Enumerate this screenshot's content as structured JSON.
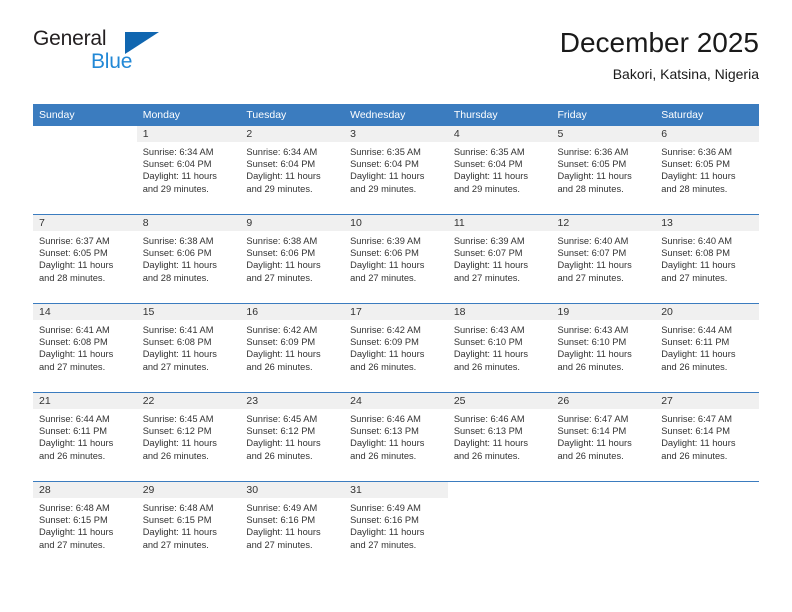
{
  "logo": {
    "line1": "General",
    "line2": "Blue",
    "triangle_color": "#1066b0",
    "blue_text_color": "#2288d6"
  },
  "header": {
    "title": "December 2025",
    "subtitle": "Bakori, Katsina, Nigeria"
  },
  "theme": {
    "header_blue": "#3b7cbf",
    "daynum_band": "#f0f0f0",
    "text": "#333333"
  },
  "weekdays": [
    "Sunday",
    "Monday",
    "Tuesday",
    "Wednesday",
    "Thursday",
    "Friday",
    "Saturday"
  ],
  "weeks": [
    [
      {
        "day": "",
        "blank": true
      },
      {
        "day": "1",
        "sunrise": "Sunrise: 6:34 AM",
        "sunset": "Sunset: 6:04 PM",
        "daylight1": "Daylight: 11 hours",
        "daylight2": "and 29 minutes."
      },
      {
        "day": "2",
        "sunrise": "Sunrise: 6:34 AM",
        "sunset": "Sunset: 6:04 PM",
        "daylight1": "Daylight: 11 hours",
        "daylight2": "and 29 minutes."
      },
      {
        "day": "3",
        "sunrise": "Sunrise: 6:35 AM",
        "sunset": "Sunset: 6:04 PM",
        "daylight1": "Daylight: 11 hours",
        "daylight2": "and 29 minutes."
      },
      {
        "day": "4",
        "sunrise": "Sunrise: 6:35 AM",
        "sunset": "Sunset: 6:04 PM",
        "daylight1": "Daylight: 11 hours",
        "daylight2": "and 29 minutes."
      },
      {
        "day": "5",
        "sunrise": "Sunrise: 6:36 AM",
        "sunset": "Sunset: 6:05 PM",
        "daylight1": "Daylight: 11 hours",
        "daylight2": "and 28 minutes."
      },
      {
        "day": "6",
        "sunrise": "Sunrise: 6:36 AM",
        "sunset": "Sunset: 6:05 PM",
        "daylight1": "Daylight: 11 hours",
        "daylight2": "and 28 minutes."
      }
    ],
    [
      {
        "day": "7",
        "sunrise": "Sunrise: 6:37 AM",
        "sunset": "Sunset: 6:05 PM",
        "daylight1": "Daylight: 11 hours",
        "daylight2": "and 28 minutes."
      },
      {
        "day": "8",
        "sunrise": "Sunrise: 6:38 AM",
        "sunset": "Sunset: 6:06 PM",
        "daylight1": "Daylight: 11 hours",
        "daylight2": "and 28 minutes."
      },
      {
        "day": "9",
        "sunrise": "Sunrise: 6:38 AM",
        "sunset": "Sunset: 6:06 PM",
        "daylight1": "Daylight: 11 hours",
        "daylight2": "and 27 minutes."
      },
      {
        "day": "10",
        "sunrise": "Sunrise: 6:39 AM",
        "sunset": "Sunset: 6:06 PM",
        "daylight1": "Daylight: 11 hours",
        "daylight2": "and 27 minutes."
      },
      {
        "day": "11",
        "sunrise": "Sunrise: 6:39 AM",
        "sunset": "Sunset: 6:07 PM",
        "daylight1": "Daylight: 11 hours",
        "daylight2": "and 27 minutes."
      },
      {
        "day": "12",
        "sunrise": "Sunrise: 6:40 AM",
        "sunset": "Sunset: 6:07 PM",
        "daylight1": "Daylight: 11 hours",
        "daylight2": "and 27 minutes."
      },
      {
        "day": "13",
        "sunrise": "Sunrise: 6:40 AM",
        "sunset": "Sunset: 6:08 PM",
        "daylight1": "Daylight: 11 hours",
        "daylight2": "and 27 minutes."
      }
    ],
    [
      {
        "day": "14",
        "sunrise": "Sunrise: 6:41 AM",
        "sunset": "Sunset: 6:08 PM",
        "daylight1": "Daylight: 11 hours",
        "daylight2": "and 27 minutes."
      },
      {
        "day": "15",
        "sunrise": "Sunrise: 6:41 AM",
        "sunset": "Sunset: 6:08 PM",
        "daylight1": "Daylight: 11 hours",
        "daylight2": "and 27 minutes."
      },
      {
        "day": "16",
        "sunrise": "Sunrise: 6:42 AM",
        "sunset": "Sunset: 6:09 PM",
        "daylight1": "Daylight: 11 hours",
        "daylight2": "and 26 minutes."
      },
      {
        "day": "17",
        "sunrise": "Sunrise: 6:42 AM",
        "sunset": "Sunset: 6:09 PM",
        "daylight1": "Daylight: 11 hours",
        "daylight2": "and 26 minutes."
      },
      {
        "day": "18",
        "sunrise": "Sunrise: 6:43 AM",
        "sunset": "Sunset: 6:10 PM",
        "daylight1": "Daylight: 11 hours",
        "daylight2": "and 26 minutes."
      },
      {
        "day": "19",
        "sunrise": "Sunrise: 6:43 AM",
        "sunset": "Sunset: 6:10 PM",
        "daylight1": "Daylight: 11 hours",
        "daylight2": "and 26 minutes."
      },
      {
        "day": "20",
        "sunrise": "Sunrise: 6:44 AM",
        "sunset": "Sunset: 6:11 PM",
        "daylight1": "Daylight: 11 hours",
        "daylight2": "and 26 minutes."
      }
    ],
    [
      {
        "day": "21",
        "sunrise": "Sunrise: 6:44 AM",
        "sunset": "Sunset: 6:11 PM",
        "daylight1": "Daylight: 11 hours",
        "daylight2": "and 26 minutes."
      },
      {
        "day": "22",
        "sunrise": "Sunrise: 6:45 AM",
        "sunset": "Sunset: 6:12 PM",
        "daylight1": "Daylight: 11 hours",
        "daylight2": "and 26 minutes."
      },
      {
        "day": "23",
        "sunrise": "Sunrise: 6:45 AM",
        "sunset": "Sunset: 6:12 PM",
        "daylight1": "Daylight: 11 hours",
        "daylight2": "and 26 minutes."
      },
      {
        "day": "24",
        "sunrise": "Sunrise: 6:46 AM",
        "sunset": "Sunset: 6:13 PM",
        "daylight1": "Daylight: 11 hours",
        "daylight2": "and 26 minutes."
      },
      {
        "day": "25",
        "sunrise": "Sunrise: 6:46 AM",
        "sunset": "Sunset: 6:13 PM",
        "daylight1": "Daylight: 11 hours",
        "daylight2": "and 26 minutes."
      },
      {
        "day": "26",
        "sunrise": "Sunrise: 6:47 AM",
        "sunset": "Sunset: 6:14 PM",
        "daylight1": "Daylight: 11 hours",
        "daylight2": "and 26 minutes."
      },
      {
        "day": "27",
        "sunrise": "Sunrise: 6:47 AM",
        "sunset": "Sunset: 6:14 PM",
        "daylight1": "Daylight: 11 hours",
        "daylight2": "and 26 minutes."
      }
    ],
    [
      {
        "day": "28",
        "sunrise": "Sunrise: 6:48 AM",
        "sunset": "Sunset: 6:15 PM",
        "daylight1": "Daylight: 11 hours",
        "daylight2": "and 27 minutes."
      },
      {
        "day": "29",
        "sunrise": "Sunrise: 6:48 AM",
        "sunset": "Sunset: 6:15 PM",
        "daylight1": "Daylight: 11 hours",
        "daylight2": "and 27 minutes."
      },
      {
        "day": "30",
        "sunrise": "Sunrise: 6:49 AM",
        "sunset": "Sunset: 6:16 PM",
        "daylight1": "Daylight: 11 hours",
        "daylight2": "and 27 minutes."
      },
      {
        "day": "31",
        "sunrise": "Sunrise: 6:49 AM",
        "sunset": "Sunset: 6:16 PM",
        "daylight1": "Daylight: 11 hours",
        "daylight2": "and 27 minutes."
      },
      {
        "day": "",
        "blank": true
      },
      {
        "day": "",
        "blank": true
      },
      {
        "day": "",
        "blank": true
      }
    ]
  ]
}
